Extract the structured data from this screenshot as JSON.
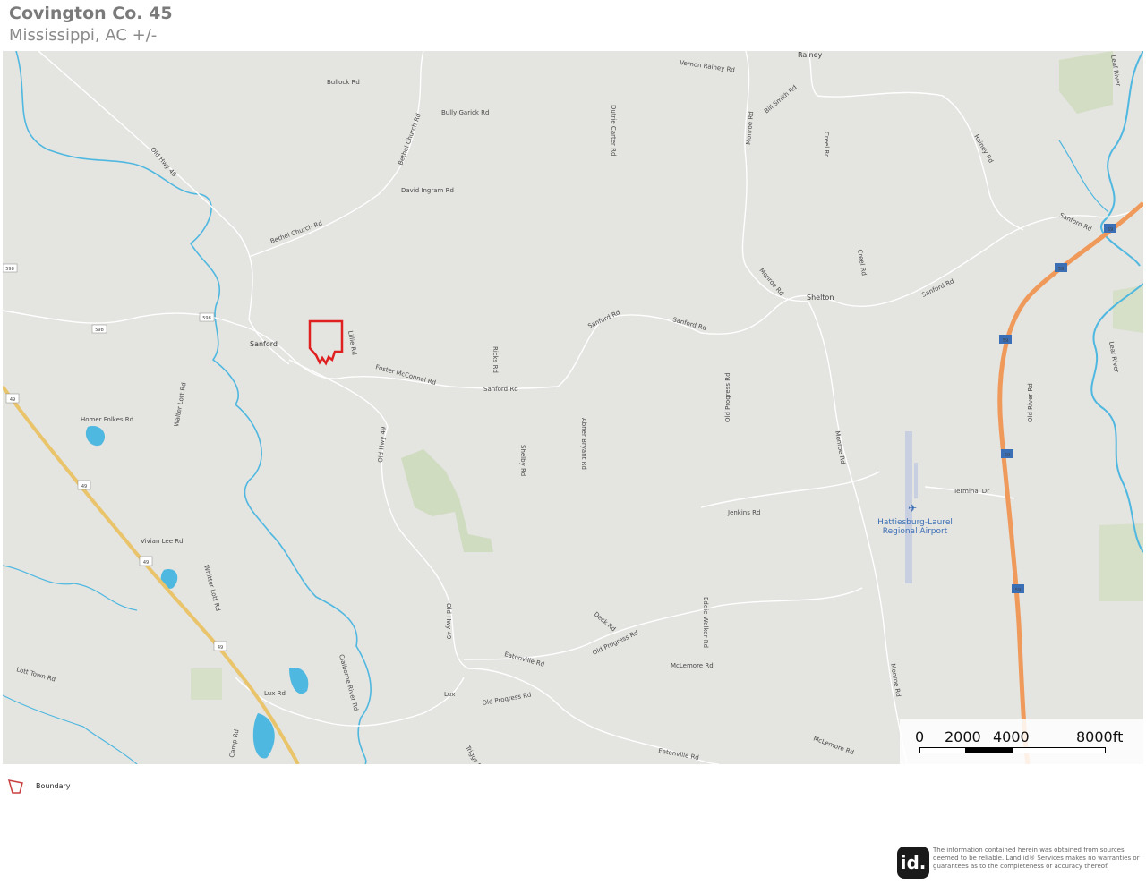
{
  "header": {
    "title": "Covington Co. 45",
    "subtitle": "Mississippi,  AC +/-"
  },
  "map": {
    "places": [
      "Rainey",
      "Sanford",
      "Shelton",
      "Lux"
    ],
    "airport": {
      "line1": "Hattiesburg-Laurel",
      "line2": "Regional Airport"
    },
    "roads": [
      "Old Hwy 49",
      "Bullock Rd",
      "Bully Garick Rd",
      "Bethel Church Rd",
      "Bethel Church Rd",
      "David Ingram Rd",
      "Dutrie Carter Rd",
      "Vernon Rainey Rd",
      "Bill Smith Rd",
      "Monroe Rd",
      "Creel Rd",
      "Rainey Rd",
      "Sanford Rd",
      "Sanford Rd",
      "Sanford Rd",
      "Sanford Rd",
      "Sanford Rd",
      "Monroe Rd",
      "Creel Rd",
      "Lillie Rd",
      "Foster McConnel Rd",
      "Ricks Rd",
      "Homer Folkes Rd",
      "Walter Lott Rd",
      "Old Hwy 49",
      "Shelby Rd",
      "Abner Bryant Rd",
      "Old Progress Rd",
      "Monroe Rd",
      "Old River Rd",
      "Terminal Dr",
      "Jenkins Rd",
      "Vivian Lee Rd",
      "Whitter Lott Rd",
      "Eatonville Rd",
      "Old Hwy 49",
      "Eddie Walker Rd",
      "Deck Rd",
      "Old Progress Rd",
      "McLemore Rd",
      "Monroe Rd",
      "Lott Town Rd",
      "Lux Rd",
      "Claiborne River Rd",
      "Old Progress Rd",
      "Eatonville Rd",
      "McLemore Rd",
      "Triggs Rd",
      "Camp Rd",
      "Lux",
      "Leaf River",
      "Leaf River"
    ],
    "shields": [
      "598",
      "598",
      "598",
      "49",
      "49",
      "49",
      "49",
      "59",
      "59",
      "59",
      "59",
      "59"
    ]
  },
  "scale": {
    "labels": [
      "0",
      "2000",
      "4000",
      "8000ft"
    ]
  },
  "legend": {
    "boundary_label": "Boundary",
    "boundary_color": "#e02020"
  },
  "footer": {
    "logo": "id.",
    "disclaimer": "The information contained herein was obtained from sources deemed to be reliable. Land id® Services makes no warranties or guarantees as to the completeness or accuracy thereof."
  },
  "colors": {
    "map_background": "#e4e4e1",
    "water": "#4fb8e0",
    "highway": "#e9c46a",
    "interstate": "#ef9a5b",
    "park": "#cfdcc0"
  }
}
